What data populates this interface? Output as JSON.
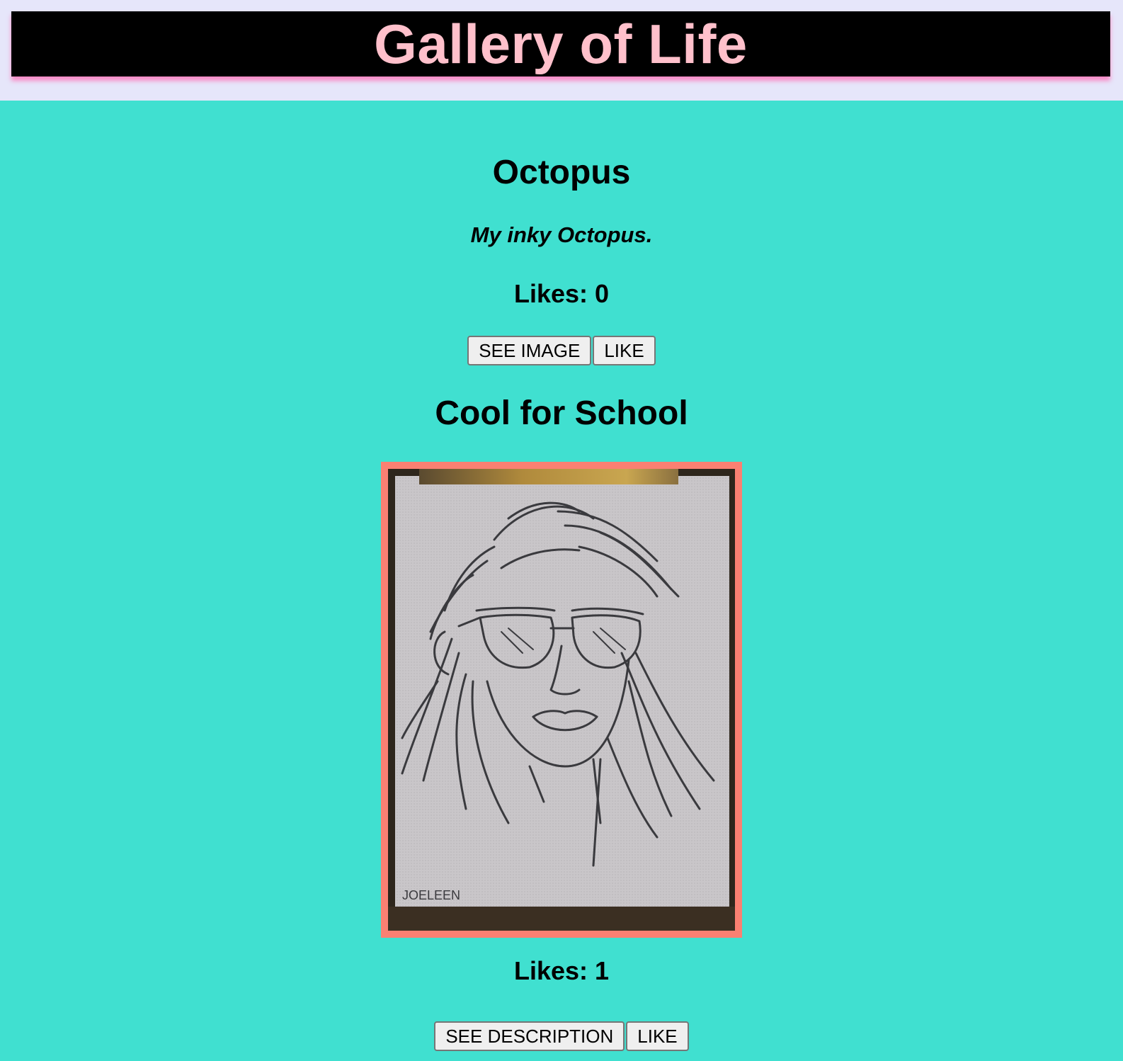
{
  "header": {
    "title": "Gallery of Life"
  },
  "artworks": [
    {
      "title": "Octopus",
      "description": "My inky Octopus.",
      "likes_label": "Likes: 0",
      "toggle_button": "SEE IMAGE",
      "like_button": "LIKE"
    },
    {
      "title": "Cool for School",
      "image_signature": "JOELEEN",
      "likes_label": "Likes: 1",
      "toggle_button": "SEE DESCRIPTION",
      "like_button": "LIKE"
    }
  ],
  "colors": {
    "page_background": "#40E0D0",
    "header_band": "#E6E6FA",
    "header_bar": "#000000",
    "title_text": "#FFC0CB",
    "header_glow": "#FF69B4",
    "image_frame": "#FA8072"
  }
}
